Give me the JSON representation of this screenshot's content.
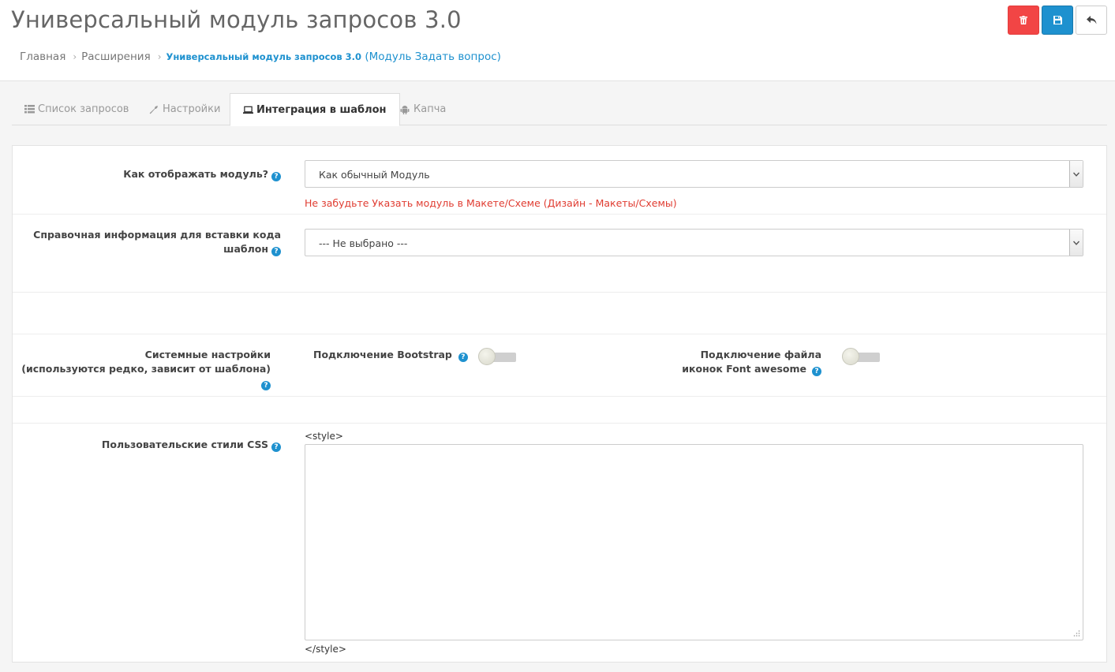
{
  "header": {
    "title": "Универсальный модуль запросов 3.0",
    "breadcrumb": {
      "home": "Главная",
      "extensions": "Расширения",
      "current_bold": "Универсальный модуль запросов 3.0",
      "current_suffix": " (Модуль Задать вопрос)"
    },
    "buttons": {
      "delete": "trash-icon",
      "save": "floppy-disk-icon",
      "back": "reply-arrow-icon"
    }
  },
  "tabs": [
    {
      "label": "Список запросов",
      "icon": "list-icon"
    },
    {
      "label": "Настройки",
      "icon": "wrench-icon"
    },
    {
      "label": "Интеграция в шаблон",
      "icon": "laptop-icon",
      "active": true
    },
    {
      "label": "Капча",
      "icon": "android-icon"
    }
  ],
  "form": {
    "display_mode": {
      "label": "Как отображать модуль?",
      "value": "Как обычный Модуль",
      "warning": "Не забудьте Указать модуль в Макете/Схеме (Дизайн - Макеты/Схемы)"
    },
    "reference_info": {
      "label_line1": "Справочная информация для вставки кода",
      "label_line2": "шаблон",
      "value": "--- Не выбрано ---"
    },
    "system_settings": {
      "label_line1": "Системные настройки",
      "label_line2": "(используются редко, зависит от шаблона)",
      "bootstrap_label": "Подключение Bootstrap",
      "fontawesome_label_line1": "Подключение файла",
      "fontawesome_label_line2": "иконок Font awesome"
    },
    "custom_css": {
      "label": "Пользовательские стили CSS",
      "open_tag": "<style>",
      "close_tag": "</style>",
      "value": ""
    }
  },
  "colors": {
    "primary": "#1e91cf",
    "danger": "#f24545",
    "warning_text": "#e03c31"
  }
}
